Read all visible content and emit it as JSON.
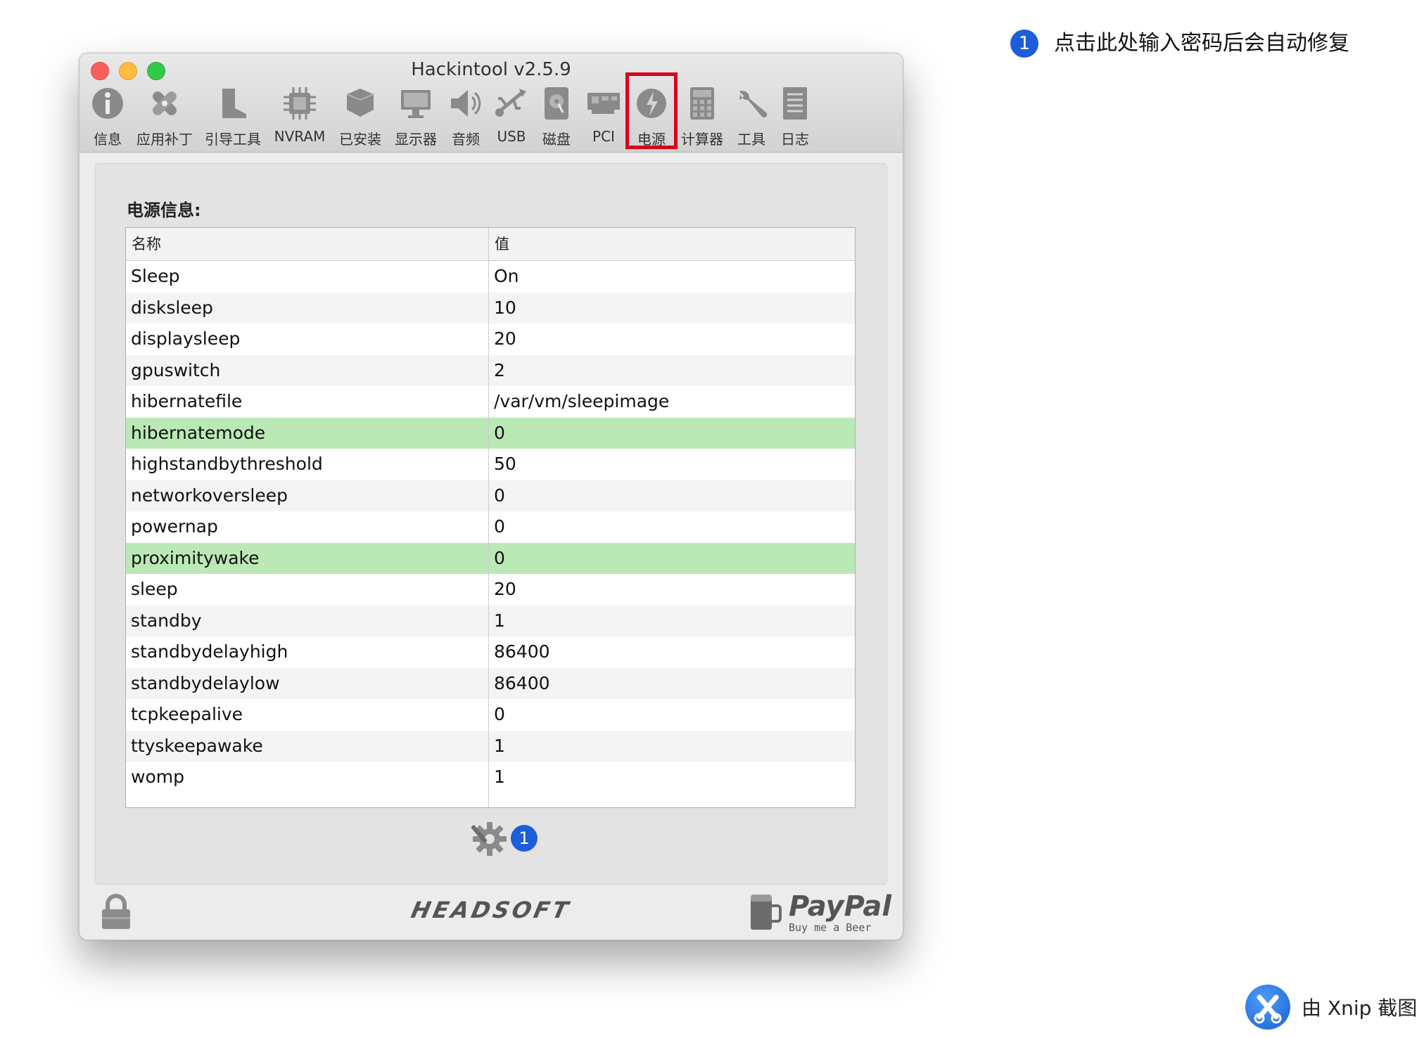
{
  "annotation": {
    "badge": "1",
    "text": "点击此处输入密码后会自动修复"
  },
  "window": {
    "title": "Hackintool v2.5.9"
  },
  "toolbar": [
    {
      "label": "信息",
      "icon": "info-icon"
    },
    {
      "label": "应用补丁",
      "icon": "bandage-icon"
    },
    {
      "label": "引导工具",
      "icon": "boot-icon"
    },
    {
      "label": "NVRAM",
      "icon": "chip-icon"
    },
    {
      "label": "已安装",
      "icon": "package-icon"
    },
    {
      "label": "显示器",
      "icon": "display-icon"
    },
    {
      "label": "音频",
      "icon": "speaker-icon"
    },
    {
      "label": "USB",
      "icon": "usb-icon"
    },
    {
      "label": "磁盘",
      "icon": "disk-icon"
    },
    {
      "label": "PCI",
      "icon": "pci-card-icon"
    },
    {
      "label": "电源",
      "icon": "power-icon"
    },
    {
      "label": "计算器",
      "icon": "calculator-icon"
    },
    {
      "label": "工具",
      "icon": "wrench-icon"
    },
    {
      "label": "日志",
      "icon": "log-icon"
    }
  ],
  "selected_tab": "电源",
  "power": {
    "section_title": "电源信息:",
    "columns": [
      "名称",
      "值"
    ],
    "rows": [
      {
        "name": "Sleep",
        "value": "On"
      },
      {
        "name": "disksleep",
        "value": "10"
      },
      {
        "name": "displaysleep",
        "value": "20"
      },
      {
        "name": "gpuswitch",
        "value": "2"
      },
      {
        "name": "hibernatefile",
        "value": "/var/vm/sleepimage"
      },
      {
        "name": "hibernatemode",
        "value": "0",
        "highlighted": true
      },
      {
        "name": "highstandbythreshold",
        "value": "50"
      },
      {
        "name": "networkoversleep",
        "value": "0"
      },
      {
        "name": "powernap",
        "value": "0"
      },
      {
        "name": "proximitywake",
        "value": "0",
        "highlighted": true
      },
      {
        "name": "sleep",
        "value": "20"
      },
      {
        "name": "standby",
        "value": "1"
      },
      {
        "name": "standbydelayhigh",
        "value": "86400"
      },
      {
        "name": "standbydelaylow",
        "value": "86400"
      },
      {
        "name": "tcpkeepalive",
        "value": "0"
      },
      {
        "name": "ttyskeepawake",
        "value": "1"
      },
      {
        "name": "womp",
        "value": "1"
      }
    ],
    "fix_badge": "1"
  },
  "footer": {
    "brand": "HEADSOFT",
    "paypal": "PayPal",
    "paypal_sub": "Buy me a Beer"
  },
  "watermark": {
    "text": "由 Xnip 截图"
  },
  "colors": {
    "highlight_row": "#bbe9b6",
    "selection_box": "#d9001b",
    "badge": "#1b5ed8"
  }
}
